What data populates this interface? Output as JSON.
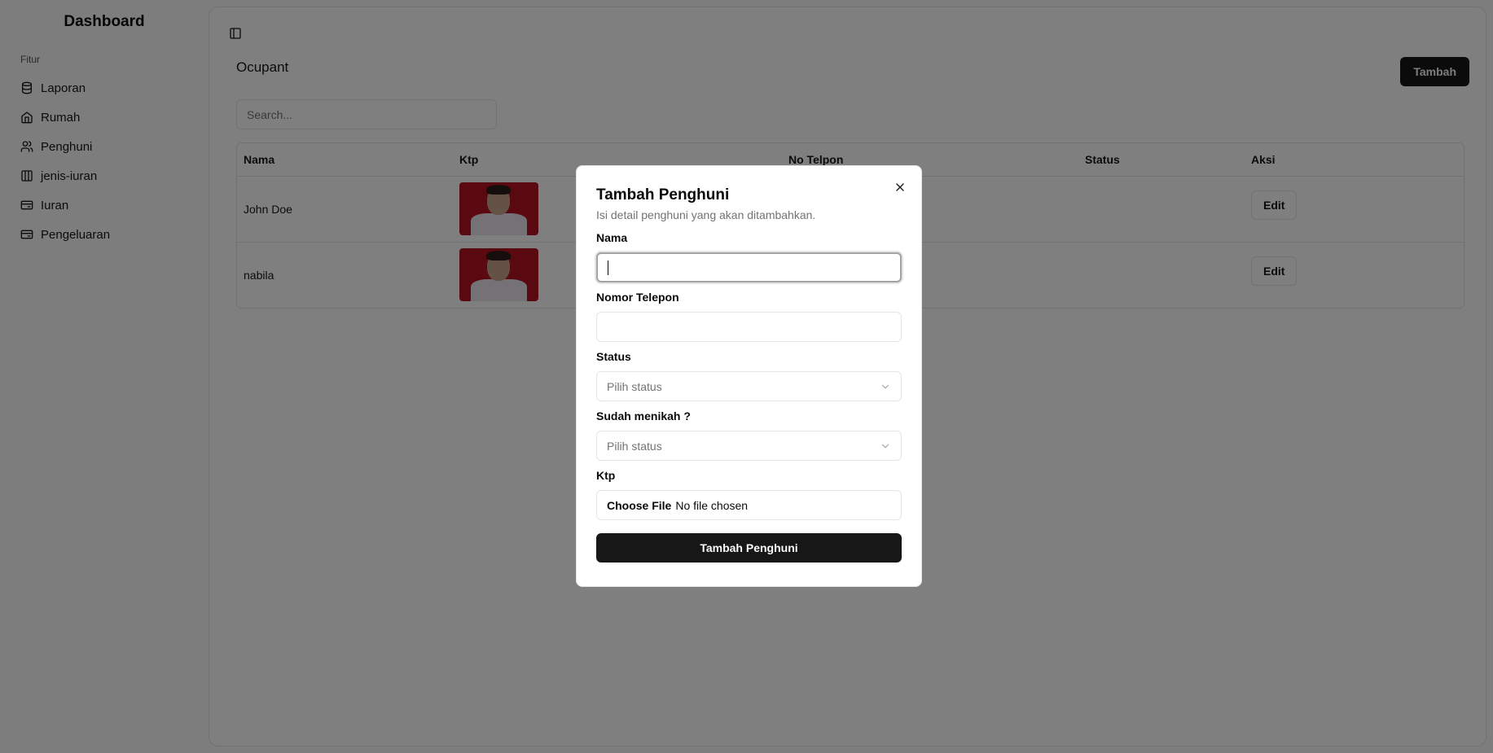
{
  "sidebar": {
    "title": "Dashboard",
    "group_label": "Fitur",
    "items": [
      {
        "label": "Laporan",
        "icon": "database-icon"
      },
      {
        "label": "Rumah",
        "icon": "home-icon"
      },
      {
        "label": "Penghuni",
        "icon": "users-icon"
      },
      {
        "label": "jenis-iuran",
        "icon": "columns-icon"
      },
      {
        "label": "Iuran",
        "icon": "wallet-icon"
      },
      {
        "label": "Pengeluaran",
        "icon": "wallet-icon"
      }
    ]
  },
  "main": {
    "title": "Ocupant",
    "add_button": "Tambah",
    "search_placeholder": "Search...",
    "table": {
      "headers": [
        "Nama",
        "Ktp",
        "No Telpon",
        "Status",
        "Aksi"
      ],
      "rows": [
        {
          "nama": "John Doe",
          "telpon": "",
          "status": "",
          "action": "Edit"
        },
        {
          "nama": "nabila",
          "telpon": "",
          "status": "",
          "action": "Edit"
        }
      ]
    }
  },
  "dialog": {
    "title": "Tambah Penghuni",
    "description": "Isi detail penghuni yang akan ditambahkan.",
    "fields": {
      "nama_label": "Nama",
      "telepon_label": "Nomor Telepon",
      "status_label": "Status",
      "status_placeholder": "Pilih status",
      "menikah_label": "Sudah menikah ?",
      "menikah_placeholder": "Pilih status",
      "ktp_label": "Ktp",
      "file_button": "Choose File",
      "file_status": "No file chosen"
    },
    "submit": "Tambah Penghuni"
  },
  "colors": {
    "primary": "#171717",
    "border": "#e5e5e5",
    "overlay": "rgba(0,0,0,0.5)",
    "ktp_bg": "#b3121e"
  }
}
